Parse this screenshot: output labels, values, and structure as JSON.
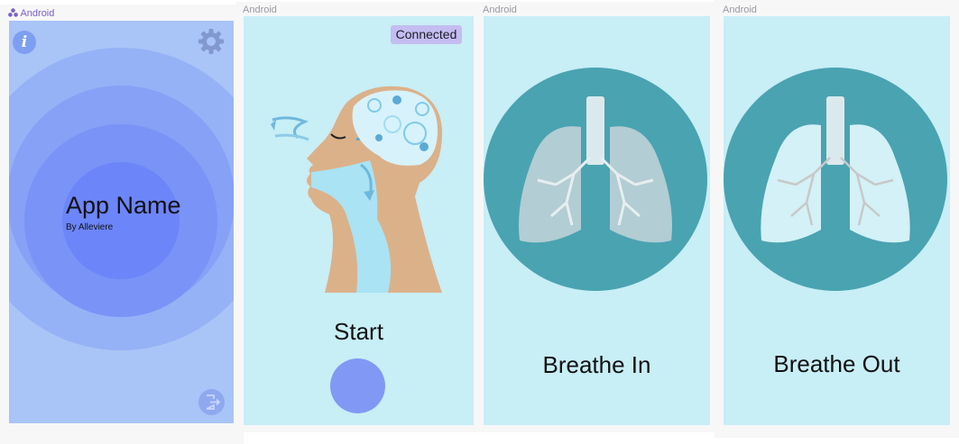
{
  "frames": [
    {
      "label": "Android",
      "label_icon": "android-icon"
    },
    {
      "label": "Android"
    },
    {
      "label": "Android"
    },
    {
      "label": "Android"
    }
  ],
  "home": {
    "app_name": "App Name",
    "byline": "By Alleviere",
    "icons": [
      "info-icon",
      "gear-icon",
      "exit-icon"
    ]
  },
  "start_screen": {
    "status_badge": "Connected",
    "start_label": "Start"
  },
  "inhale_screen": {
    "label": "Breathe In"
  },
  "exhale_screen": {
    "label": "Breathe Out"
  },
  "colors": {
    "accent": "#8199f4",
    "screen_background": "#c8eef6",
    "lung_disc": "#4aa3b1",
    "badge": "#c4bdf1",
    "home_rings": [
      "#a9c4f7",
      "#95b2f6",
      "#86a1f5",
      "#7993f7",
      "#6c85f9"
    ]
  }
}
